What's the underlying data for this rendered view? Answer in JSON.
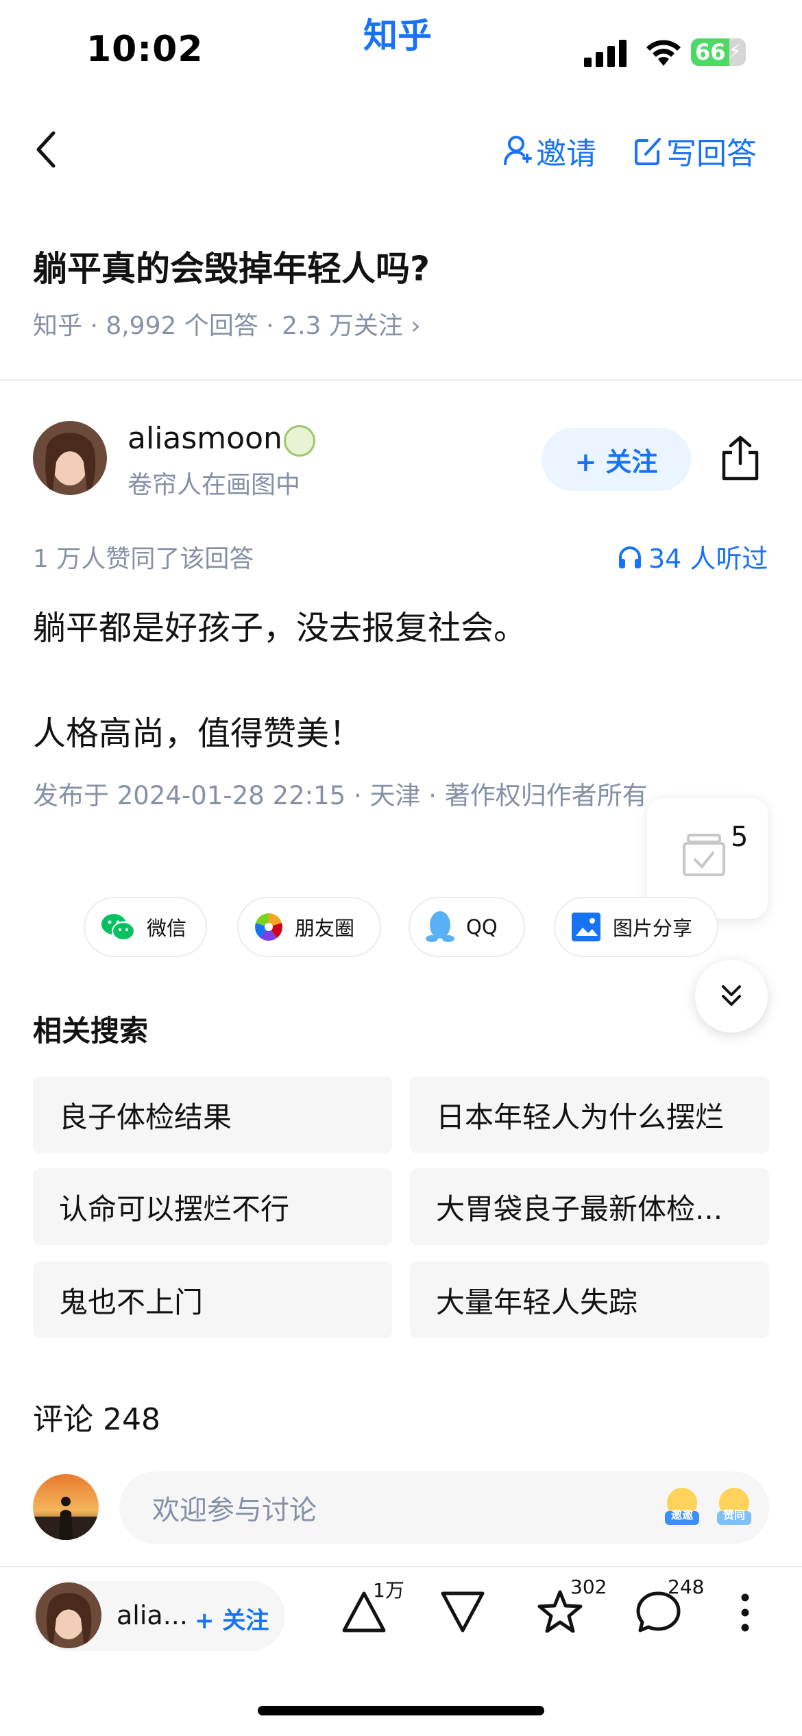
{
  "status_bar": {
    "time": "10:02",
    "app_title": "知乎",
    "battery": "66"
  },
  "nav": {
    "invite_label": "邀请",
    "write_label": "写回答"
  },
  "question": {
    "title": "躺平真的会毁掉年轻人吗?",
    "meta": "知乎 · 8,992 个回答 · 2.3 万关注 ›"
  },
  "author": {
    "name": "aliasmoon",
    "bio": "卷帘人在画图中",
    "follow_label": "+ 关注"
  },
  "answer": {
    "votes_text": "1 万人赞同了该回答",
    "listened_text": "34 人听过",
    "paragraphs": [
      "躺平都是好孩子，没去报复社会。",
      "人格高尚，值得赞美！"
    ],
    "publish_meta": "发布于 2024-01-28 22:15 · 天津 · 著作权归作者所有"
  },
  "floating": {
    "count": "5"
  },
  "share": {
    "wechat": "微信",
    "moments": "朋友圈",
    "qq": "QQ",
    "image_share": "图片分享"
  },
  "related": {
    "title": "相关搜索",
    "items": [
      "良子体检结果",
      "日本年轻人为什么摆烂",
      "认命可以摆烂不行",
      "大胃袋良子最新体检...",
      "鬼也不上门",
      "大量年轻人失踪"
    ]
  },
  "comments": {
    "title": "评论 248",
    "placeholder": "欢迎参与讨论",
    "emoji_1": "邀邀",
    "emoji_2": "赞同"
  },
  "bottom_bar": {
    "user_name": "alia...",
    "follow_label": "+ 关注",
    "upvote_count": "1万",
    "star_count": "302",
    "comment_count": "248"
  },
  "colors": {
    "brand": "#1772f6",
    "text_primary": "#121212",
    "text_secondary": "#8590a6",
    "battery": "#4cd964"
  }
}
